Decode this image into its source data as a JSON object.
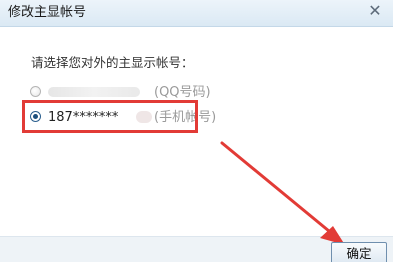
{
  "dialog": {
    "title": "修改主显帐号",
    "close_glyph": "✕"
  },
  "prompt": "请选择您对外的主显示帐号：",
  "options": [
    {
      "account": "",
      "type_label": "(QQ号码)",
      "selected": false
    },
    {
      "account": "187*******",
      "type_label": "(手机帐号)",
      "selected": true
    }
  ],
  "ok_button": "确定",
  "colors": {
    "highlight": "#e23b36",
    "arrow": "#e23b36",
    "title_bar": "#dbe9f4"
  }
}
